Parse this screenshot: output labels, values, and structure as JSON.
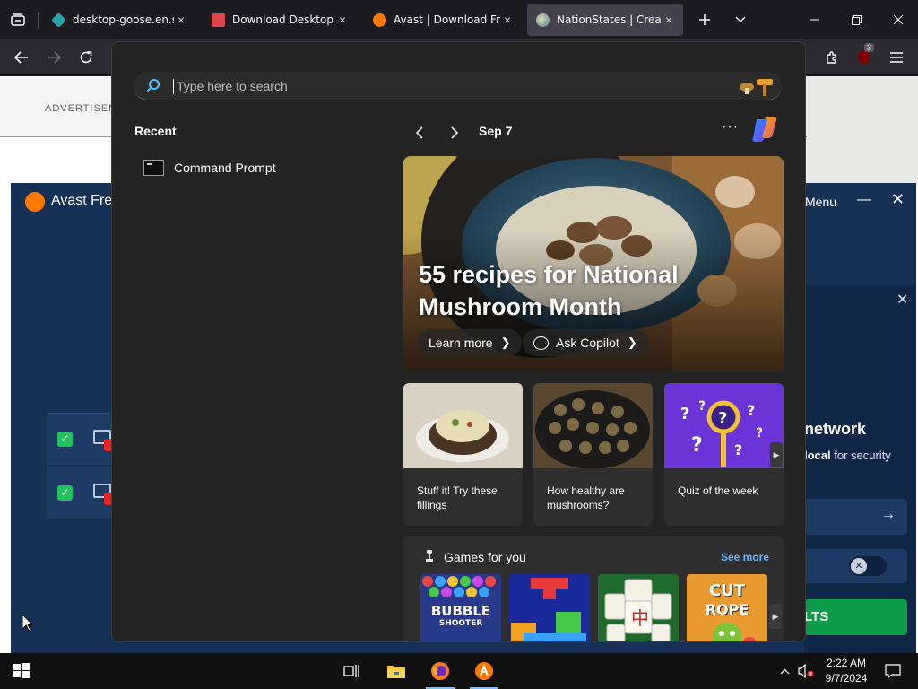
{
  "browser": {
    "tabs": [
      {
        "title": "desktop-goose.en.softo",
        "favicon_color": "#27a0a8",
        "active": false
      },
      {
        "title": "Download Desktop Goo",
        "favicon_color": "#e2444b",
        "active": false
      },
      {
        "title": "Avast | Download Free A",
        "favicon_color": "#ff7800",
        "active": false
      },
      {
        "title": "NationStates | Create a",
        "favicon_color": "#7a8fa6",
        "active": true
      }
    ],
    "close_glyph": "×",
    "extension_badge": "3"
  },
  "page": {
    "ad_label": "ADVERTISEMENT"
  },
  "avast": {
    "app_name": "Avast Free",
    "menu_label": "Menu",
    "panel_title": "network",
    "panel_sub_bold": "local",
    "panel_sub_rest": " for security",
    "cta_label": "LTS",
    "brand_color": "#ff7800"
  },
  "start": {
    "search_placeholder": "Type here to search",
    "recent_title": "Recent",
    "recent_items": [
      {
        "label": "Command Prompt",
        "icon": "command-prompt-icon"
      }
    ],
    "feed": {
      "date": "Sep 7",
      "hero": {
        "title": "55 recipes for National Mushroom Month",
        "learn_more": "Learn more",
        "ask_copilot": "Ask Copilot"
      },
      "cards": [
        {
          "text": "Stuff it! Try these fillings"
        },
        {
          "text": "How healthy are mushrooms?"
        },
        {
          "text": "Quiz of the week"
        }
      ],
      "games": {
        "title": "Games for you",
        "see_more": "See more",
        "tiles": [
          {
            "name": "Bubble Shooter",
            "label_line1": "BUBBLE",
            "label_line2": "SHOOTER"
          },
          {
            "name": "Tetris-style blocks"
          },
          {
            "name": "Mahjong"
          },
          {
            "name": "Cut the Rope",
            "label_line1": "CUT",
            "label_line2": "ROPE"
          }
        ]
      }
    }
  },
  "taskbar": {
    "time": "2:22 AM",
    "date": "9/7/2024",
    "accent_color": "#8ab6e8"
  }
}
